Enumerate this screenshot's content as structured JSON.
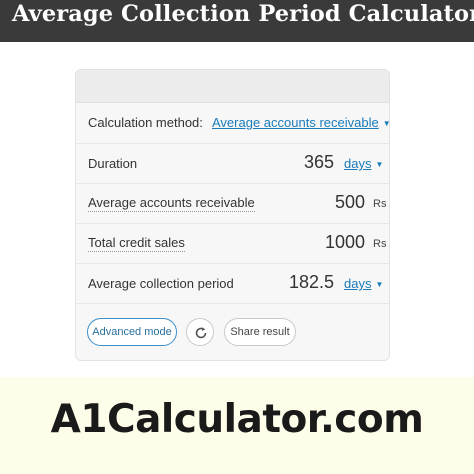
{
  "page_title": "Average Collection Period Calculator",
  "form": {
    "method": {
      "label": "Calculation method:",
      "selected": "Average accounts receivable"
    },
    "duration": {
      "label": "Duration",
      "value": "365",
      "unit": "days"
    },
    "avg_receivable": {
      "label": "Average accounts receivable",
      "value": "500",
      "unit": "Rs"
    },
    "credit_sales": {
      "label": "Total credit sales",
      "value": "1000",
      "unit": "Rs"
    },
    "collection_period": {
      "label": "Average collection period",
      "value": "182.5",
      "unit": "days"
    }
  },
  "buttons": {
    "advanced": "Advanced mode",
    "share": "Share result",
    "refresh_icon": "refresh-icon"
  },
  "footer": {
    "brand": "A1Calculator.com"
  },
  "colors": {
    "banner": "#3a3a3a",
    "link": "#1a7bb9",
    "footer_bg": "#fefdea"
  }
}
